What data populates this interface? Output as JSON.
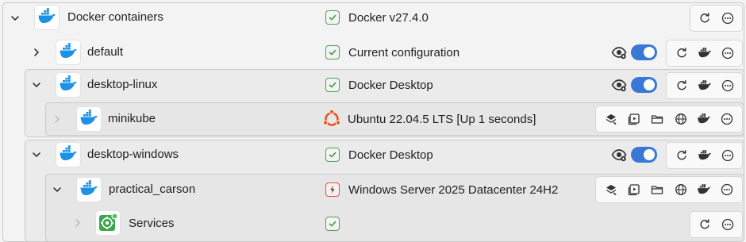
{
  "rows": [
    {
      "label": "Docker containers",
      "status": "Docker v27.4.0"
    },
    {
      "label": "default",
      "status": "Current configuration"
    },
    {
      "label": "desktop-linux",
      "status": "Docker Desktop"
    },
    {
      "label": "minikube",
      "status": "Ubuntu 22.04.5 LTS [Up 1 seconds]"
    },
    {
      "label": "desktop-windows",
      "status": "Docker Desktop"
    },
    {
      "label": "practical_carson",
      "status": "Windows Server 2025 Datacenter 24H2"
    },
    {
      "label": "Services",
      "status": ""
    }
  ],
  "icons": {
    "expand": "chevron-down-icon",
    "collapse": "chevron-right-icon",
    "docker": "docker-whale-icon",
    "ubuntu": "ubuntu-logo-icon",
    "services": "services-icon",
    "ok": "check-icon",
    "error": "lightning-icon",
    "refresh": "refresh-icon",
    "more": "more-icon",
    "eye": "eye-icon"
  },
  "colors": {
    "docker_blue": "#1d91e6",
    "toggle_on": "#3a78d6",
    "ok_green": "#5a9b60",
    "error_red": "#d6564a",
    "ubuntu_orange": "#e95420"
  },
  "toggles": {
    "default": true,
    "desktop-linux": true,
    "desktop-windows": true
  }
}
